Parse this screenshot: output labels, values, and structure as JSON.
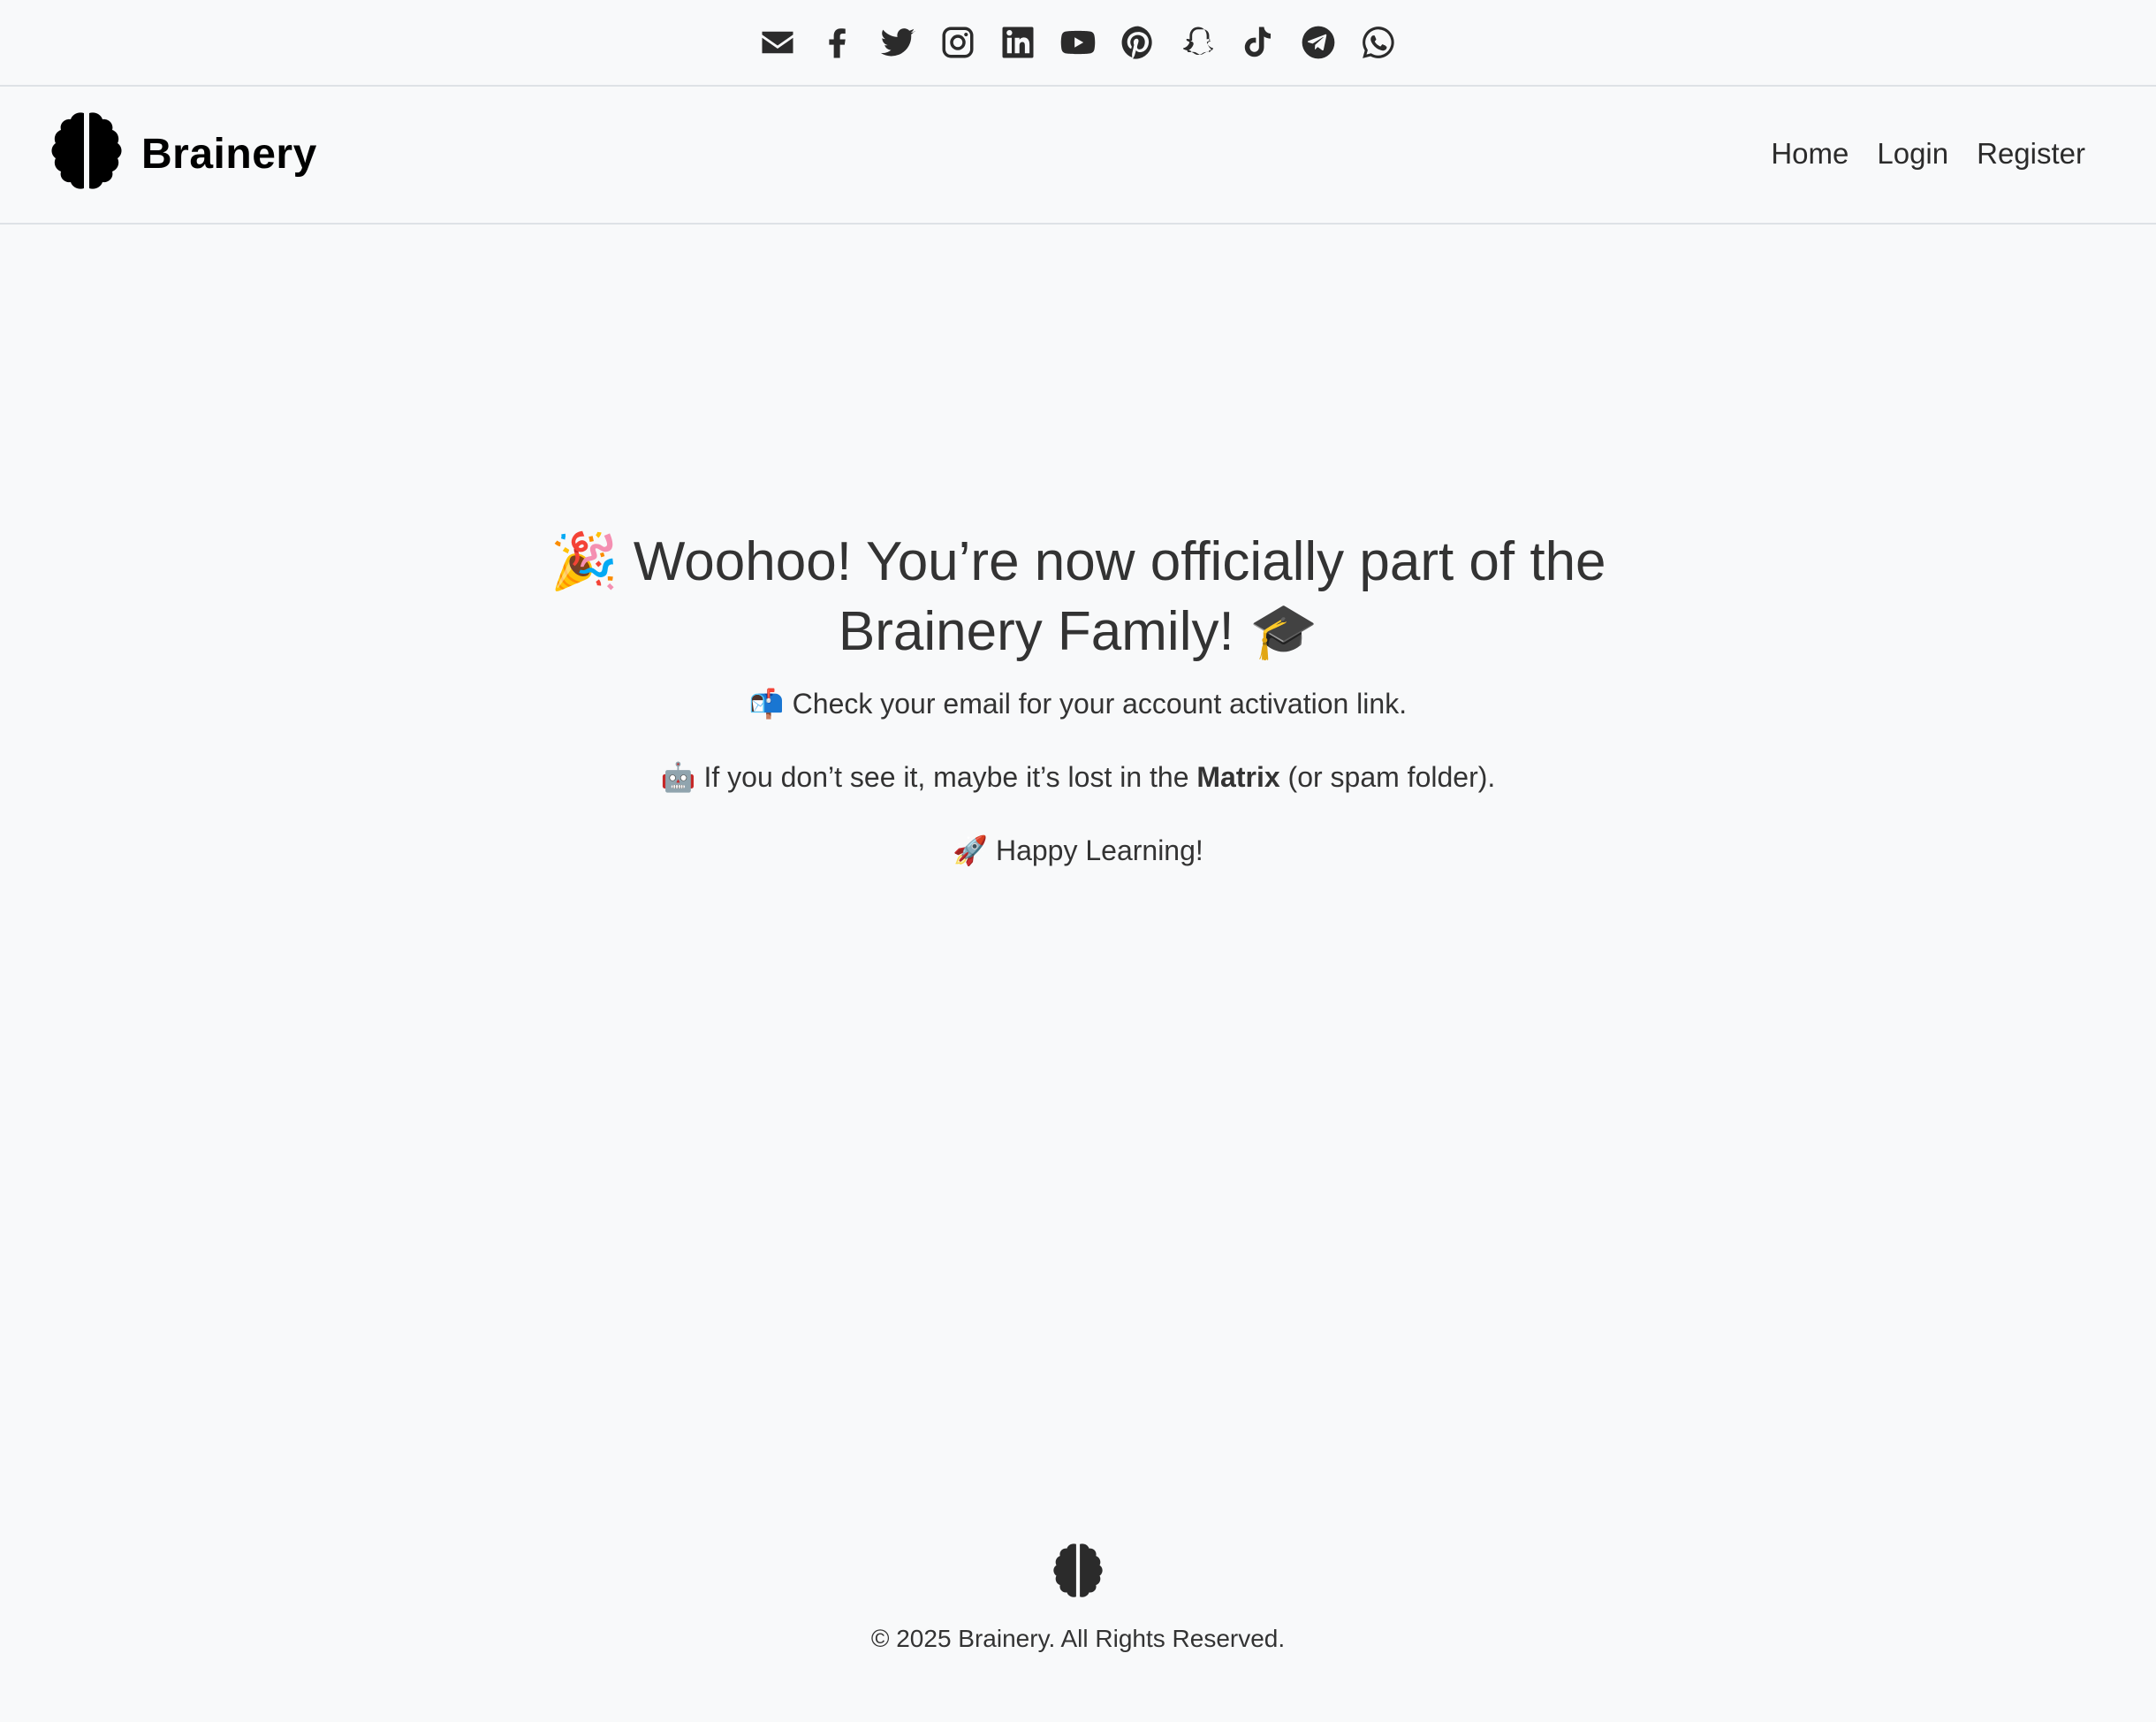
{
  "social": [
    {
      "name": "email-icon",
      "icon": "envelope"
    },
    {
      "name": "facebook-icon",
      "icon": "facebook"
    },
    {
      "name": "twitter-icon",
      "icon": "twitter"
    },
    {
      "name": "instagram-icon",
      "icon": "instagram"
    },
    {
      "name": "linkedin-icon",
      "icon": "linkedin"
    },
    {
      "name": "youtube-icon",
      "icon": "youtube"
    },
    {
      "name": "pinterest-icon",
      "icon": "pinterest"
    },
    {
      "name": "snapchat-icon",
      "icon": "snapchat"
    },
    {
      "name": "tiktok-icon",
      "icon": "tiktok"
    },
    {
      "name": "telegram-icon",
      "icon": "telegram"
    },
    {
      "name": "whatsapp-icon",
      "icon": "whatsapp"
    }
  ],
  "brand": {
    "name": "Brainery",
    "logo_icon": "brain"
  },
  "nav": {
    "home": "Home",
    "login": "Login",
    "register": "Register"
  },
  "hero": {
    "title_emoji_start": "🎉",
    "title": "Woohoo! You’re now officially part of the Brainery Family!",
    "title_emoji_end": "🎓",
    "line1_emoji": "📬",
    "line1": "Check your email for your account activation link.",
    "line2_emoji": "🤖",
    "line2_before": "If you don’t see it, maybe it’s lost in the",
    "line2_bold": "Matrix",
    "line2_after": "(or spam folder).",
    "line3_emoji": "🚀",
    "line3": "Happy Learning!"
  },
  "footer": {
    "logo_icon": "brain",
    "copyright": "© 2025 Brainery. All Rights Reserved."
  },
  "colors": {
    "background": "#f8f9fa",
    "text": "#333333",
    "brand": "#000000",
    "divider": "#dee2e6"
  }
}
